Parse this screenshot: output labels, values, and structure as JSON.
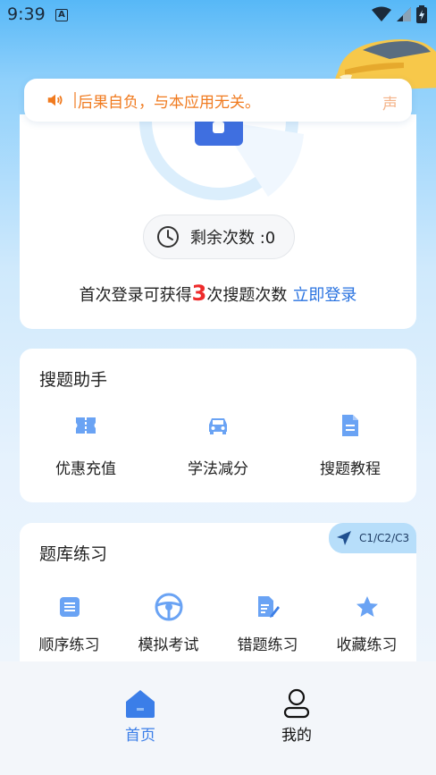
{
  "status_bar": {
    "time": "9:39",
    "notification_glyph": "A"
  },
  "notice": {
    "text": "后果自负，与本应用无关。",
    "tail": "声"
  },
  "quota": {
    "remaining_label": "剩余次数 :0",
    "login_prefix": "首次登录可获得",
    "login_count": "3",
    "login_suffix": "次搜题次数",
    "login_link": "立即登录"
  },
  "helper": {
    "title": "搜题助手",
    "items": [
      {
        "label": "优惠充值",
        "icon": "coupon-icon"
      },
      {
        "label": "学法减分",
        "icon": "car-icon"
      },
      {
        "label": "搜题教程",
        "icon": "document-icon"
      }
    ]
  },
  "bank": {
    "title": "题库练习",
    "license_tag": "C1/C2/C3",
    "items": [
      {
        "label": "顺序练习",
        "icon": "list-icon"
      },
      {
        "label": "模拟考试",
        "icon": "steering-wheel-icon"
      },
      {
        "label": "错题练习",
        "icon": "edit-doc-icon"
      },
      {
        "label": "收藏练习",
        "icon": "star-icon"
      }
    ]
  },
  "nav": {
    "home": "首页",
    "me": "我的"
  },
  "colors": {
    "accent": "#3b7ee8",
    "icon_blue": "#6aa3f4",
    "notice_orange": "#f07a1e",
    "highlight_red": "#ee2b2b"
  }
}
